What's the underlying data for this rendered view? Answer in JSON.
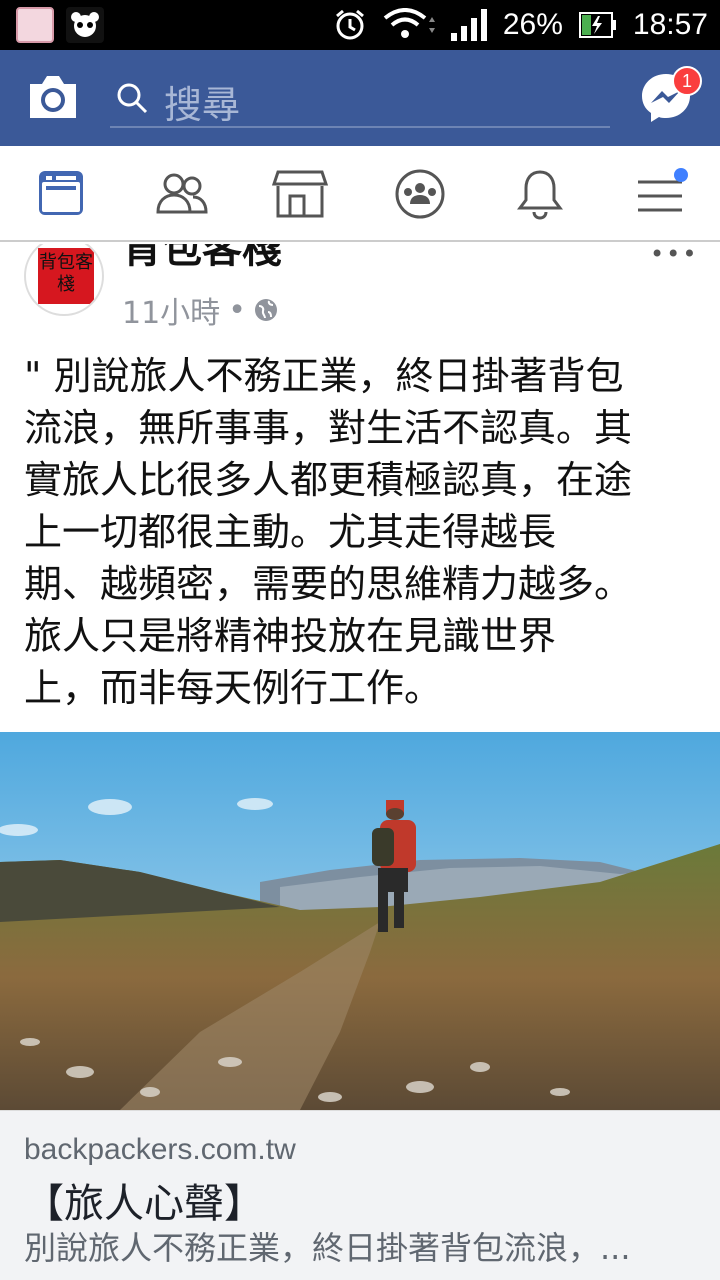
{
  "status_bar": {
    "battery": "26%",
    "time": "18:57",
    "icons": [
      "notification-thumb-icon",
      "panda-icon",
      "alarm-icon",
      "wifi-icon",
      "signal-icon",
      "battery-charging-icon"
    ]
  },
  "header": {
    "search_placeholder": "搜尋",
    "messenger_badge": "1"
  },
  "tabs": [
    {
      "name": "news-feed",
      "icon": "news-feed-icon",
      "active": true
    },
    {
      "name": "friends",
      "icon": "friends-icon"
    },
    {
      "name": "marketplace",
      "icon": "marketplace-icon"
    },
    {
      "name": "groups",
      "icon": "groups-icon"
    },
    {
      "name": "notifications",
      "icon": "bell-icon"
    },
    {
      "name": "menu",
      "icon": "menu-icon",
      "has_dot": true
    }
  ],
  "post": {
    "page_name": "背包客棧",
    "avatar_text": "背包客棧",
    "time": "11小時",
    "separator": "•",
    "body": "\" 別說旅人不務正業，終日掛著背包\n流浪，無所事事，對生活不認真。其\n實旅人比很多人都更積極認真，在途\n上一切都很主動。尤其走得越長\n期、越頻密，需要的思維精力越多。\n旅人只是將精神投放在見識世界\n上，而非每天例行工作。"
  },
  "link_preview": {
    "domain": "backpackers.com.tw",
    "title": "【旅人心聲】",
    "description": "別說旅人不務正業，終日掛著背包流浪，..."
  },
  "colors": {
    "fb_blue": "#3b5998",
    "badge_red": "#fa3e3e",
    "active_tab": "#4267b2"
  }
}
